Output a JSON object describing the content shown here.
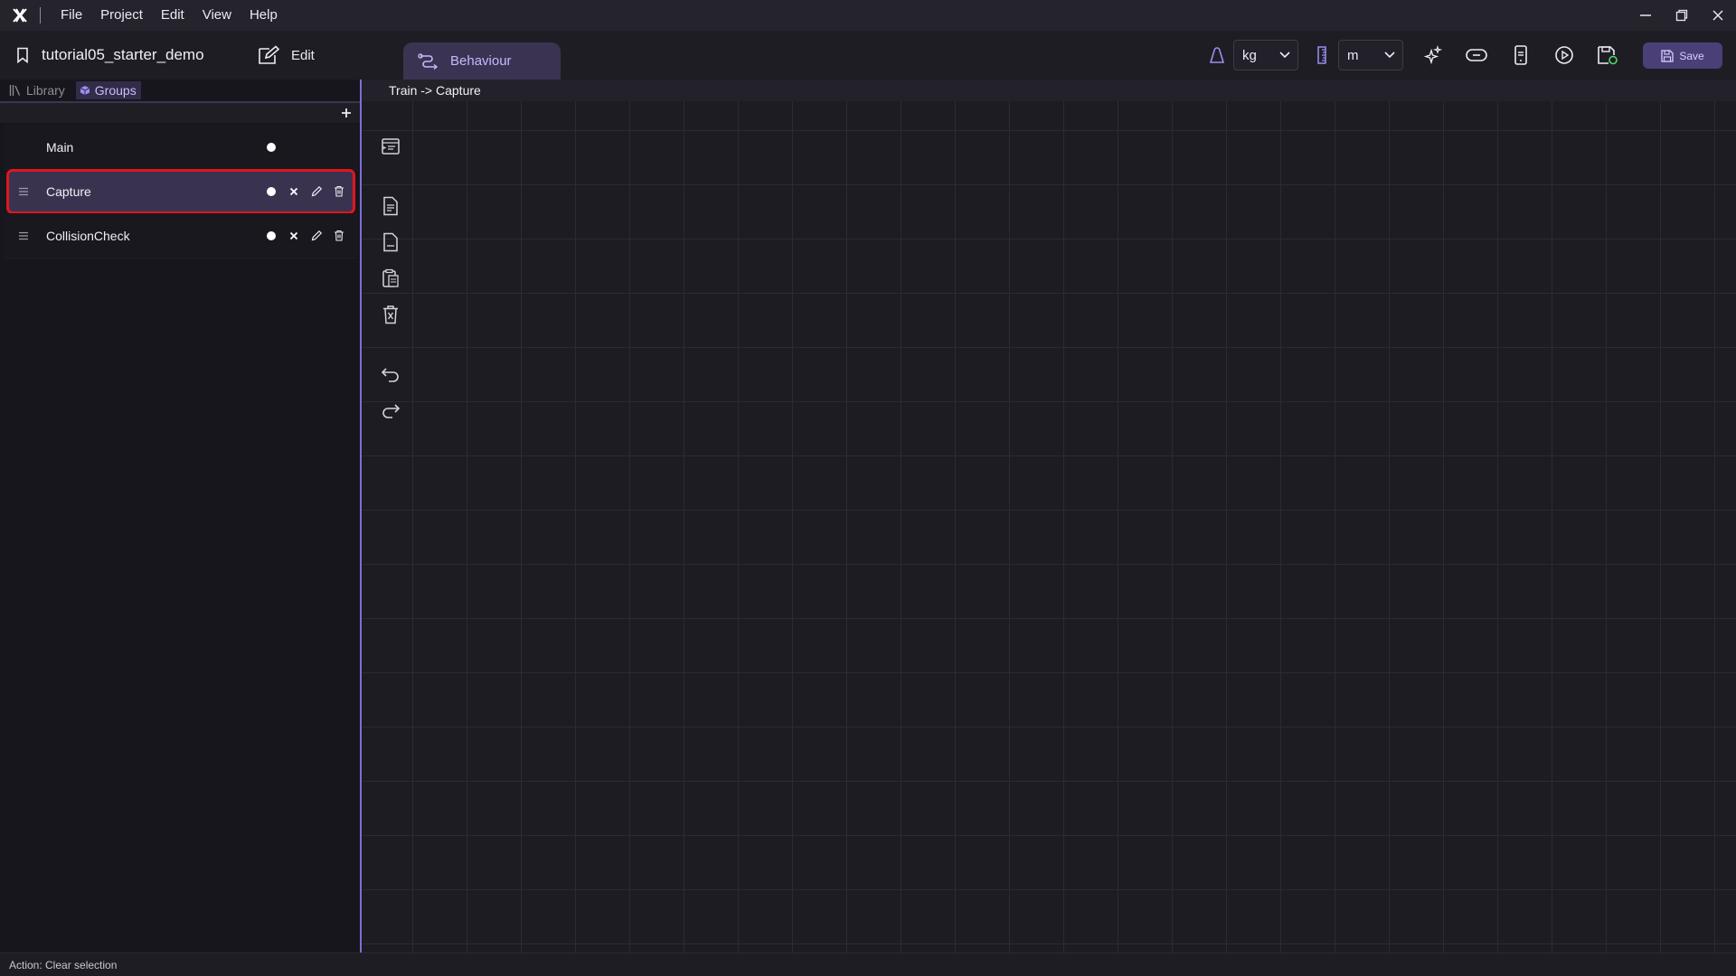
{
  "menu": {
    "items": [
      "File",
      "Project",
      "Edit",
      "View",
      "Help"
    ]
  },
  "toolbar": {
    "project_name": "tutorial05_starter_demo",
    "edit_label": "Edit",
    "behaviour_tab": "Behaviour",
    "mass_unit": "kg",
    "length_unit": "m",
    "save_label": "Save"
  },
  "left_panel": {
    "tabs": [
      {
        "label": "Library",
        "active": false
      },
      {
        "label": "Groups",
        "active": true
      }
    ],
    "groups": [
      {
        "name": "Main",
        "selected": false
      },
      {
        "name": "Capture",
        "selected": true
      },
      {
        "name": "CollisionCheck",
        "selected": false
      }
    ]
  },
  "canvas": {
    "breadcrumb": "Train -> Capture"
  },
  "status": {
    "text": "Action: Clear selection"
  },
  "colors": {
    "accent": "#7d6fd6",
    "selected_row": "#3a3350",
    "highlight_outline": "#e0161f",
    "save_button": "#4b3f78"
  }
}
